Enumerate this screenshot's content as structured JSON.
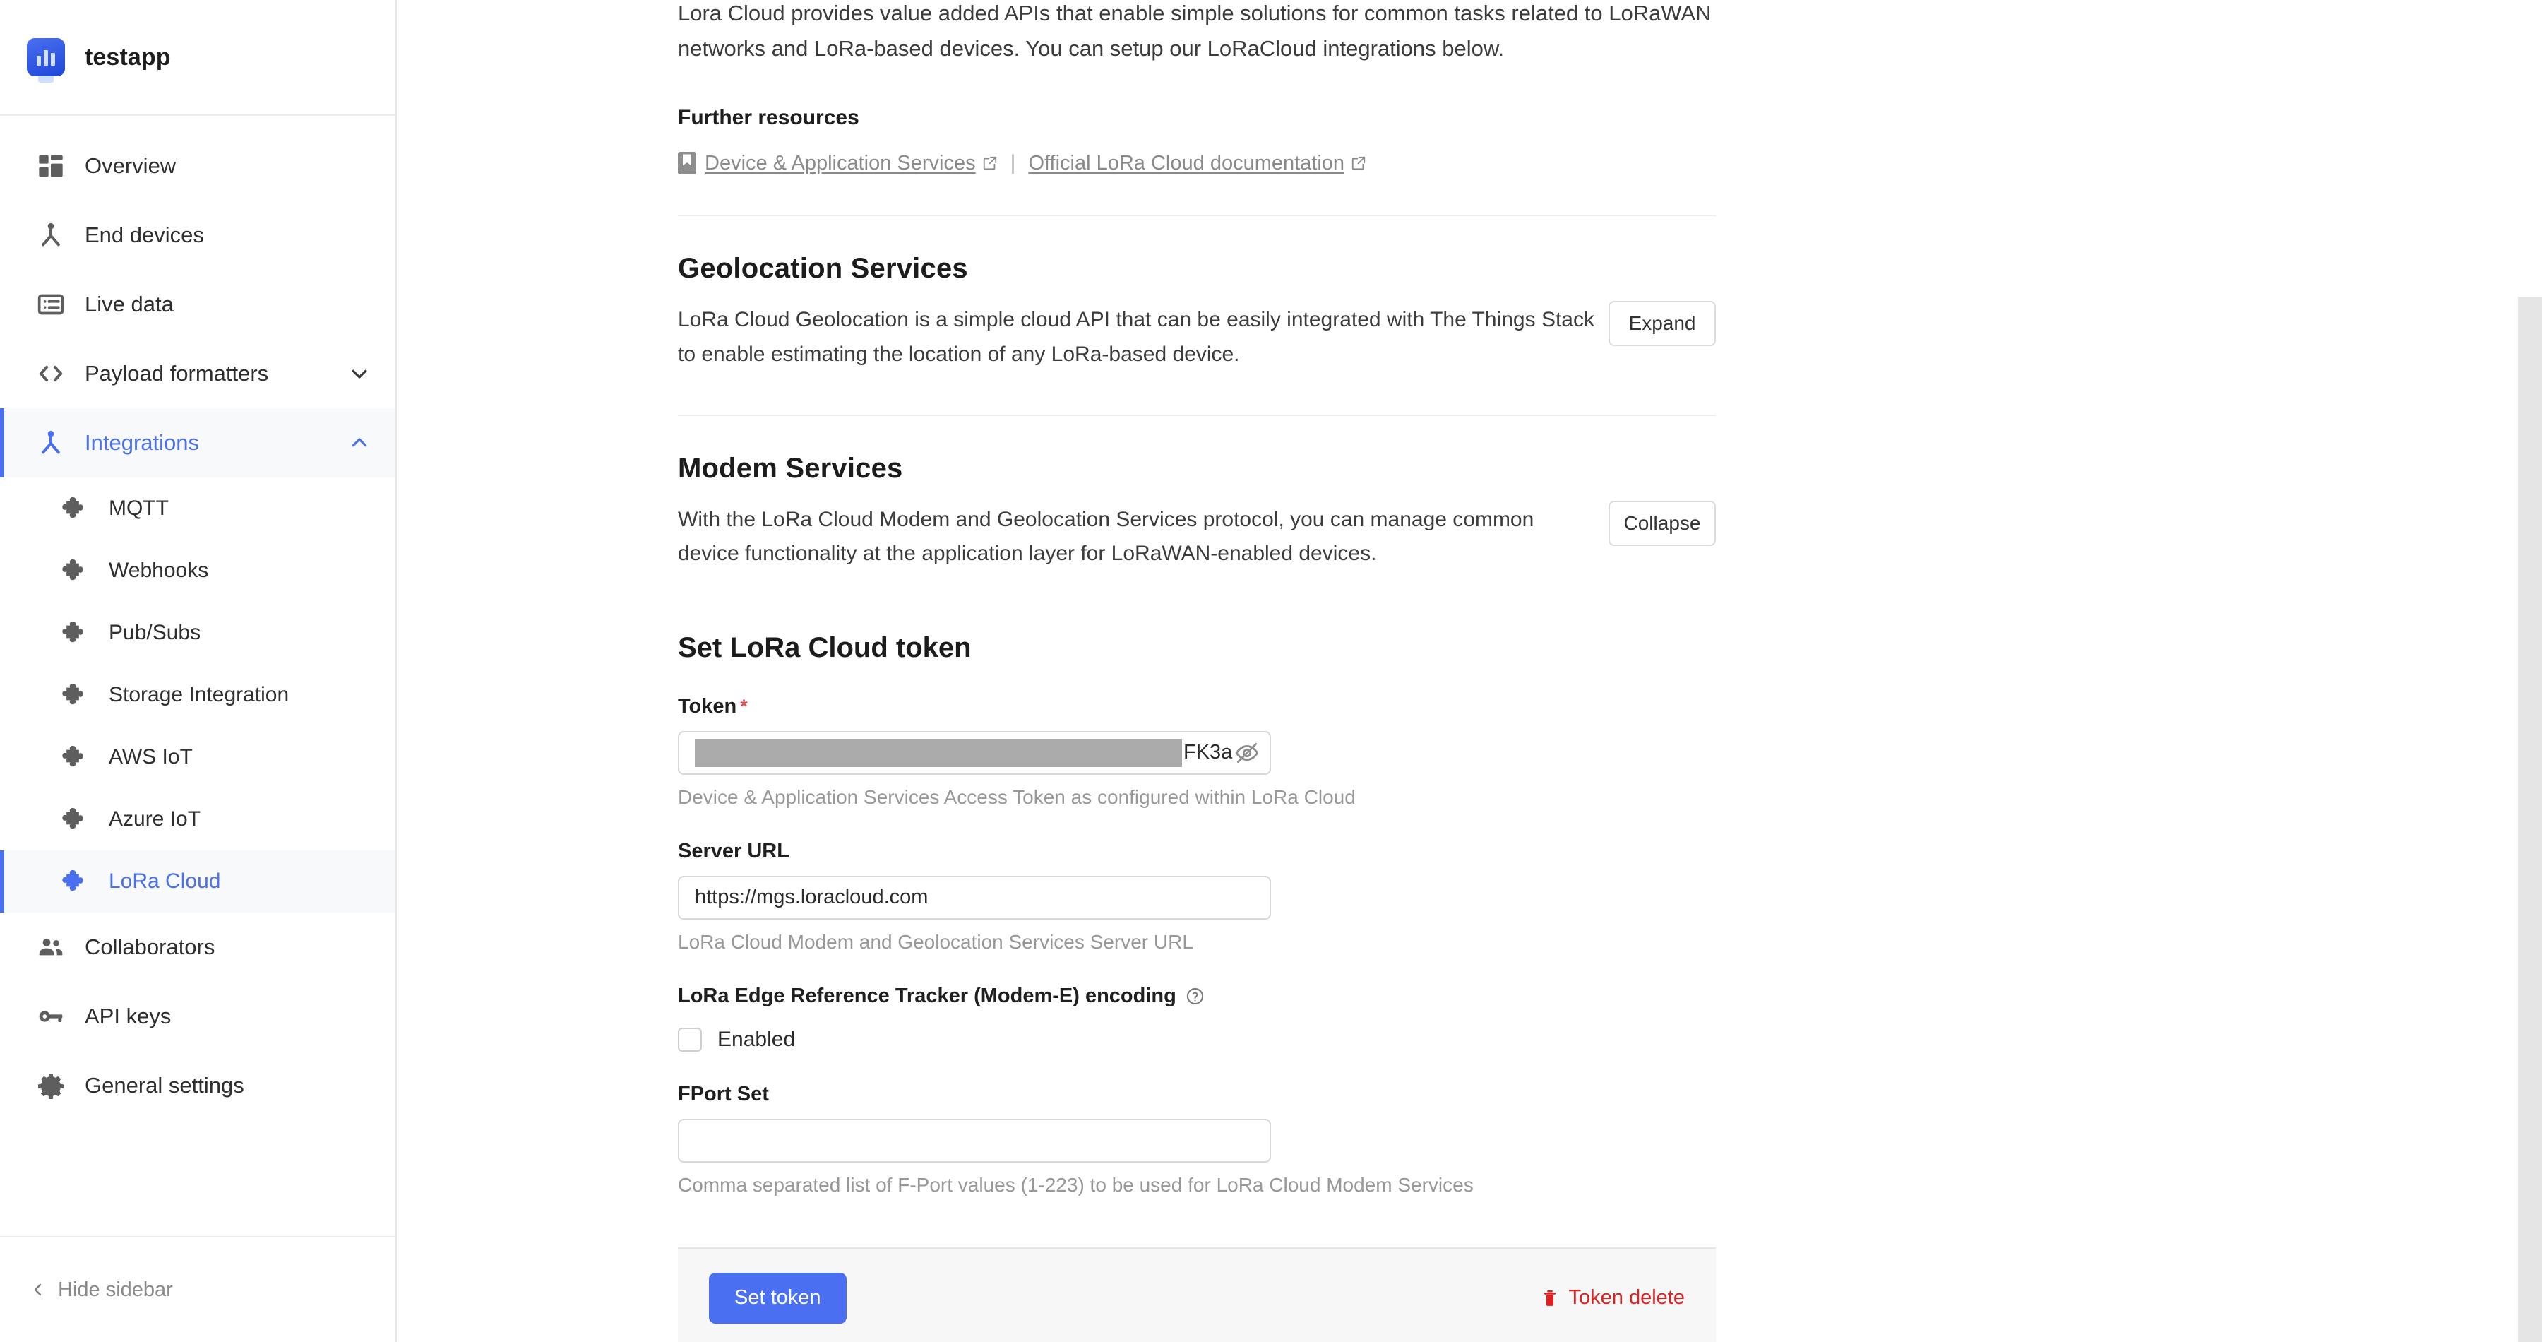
{
  "brand": {
    "name": "testapp",
    "logo_icon": "bar-chart-monitor-icon"
  },
  "sidebar": {
    "items": [
      {
        "label": "Overview",
        "icon": "dashboard-grid-icon",
        "level": "top",
        "active": false,
        "chevron": ""
      },
      {
        "label": "End devices",
        "icon": "end-device-node-icon",
        "level": "top",
        "active": false,
        "chevron": ""
      },
      {
        "label": "Live data",
        "icon": "live-data-list-icon",
        "level": "top",
        "active": false,
        "chevron": ""
      },
      {
        "label": "Payload formatters",
        "icon": "code-brackets-icon",
        "level": "top",
        "active": false,
        "chevron": "chevron-down-icon"
      },
      {
        "label": "Integrations",
        "icon": "integrations-node-icon",
        "level": "top",
        "active": true,
        "chevron": "chevron-up-icon"
      },
      {
        "label": "MQTT",
        "icon": "puzzle-piece-icon",
        "level": "sub",
        "active": false,
        "chevron": ""
      },
      {
        "label": "Webhooks",
        "icon": "puzzle-piece-icon",
        "level": "sub",
        "active": false,
        "chevron": ""
      },
      {
        "label": "Pub/Subs",
        "icon": "puzzle-piece-icon",
        "level": "sub",
        "active": false,
        "chevron": ""
      },
      {
        "label": "Storage Integration",
        "icon": "puzzle-piece-icon",
        "level": "sub",
        "active": false,
        "chevron": ""
      },
      {
        "label": "AWS IoT",
        "icon": "puzzle-piece-icon",
        "level": "sub",
        "active": false,
        "chevron": ""
      },
      {
        "label": "Azure IoT",
        "icon": "puzzle-piece-icon",
        "level": "sub",
        "active": false,
        "chevron": ""
      },
      {
        "label": "LoRa Cloud",
        "icon": "puzzle-piece-icon",
        "level": "sub",
        "active": true,
        "chevron": ""
      },
      {
        "label": "Collaborators",
        "icon": "collaborators-people-icon",
        "level": "top",
        "active": false,
        "chevron": ""
      },
      {
        "label": "API keys",
        "icon": "key-icon",
        "level": "top",
        "active": false,
        "chevron": ""
      },
      {
        "label": "General settings",
        "icon": "gear-icon",
        "level": "top",
        "active": false,
        "chevron": ""
      }
    ],
    "hide_sidebar_label": "Hide sidebar"
  },
  "main": {
    "intro_paragraph": "Lora Cloud provides value added APIs that enable simple solutions for common tasks related to LoRaWAN networks and LoRa-based devices. You can setup our LoRaCloud integrations below.",
    "further_resources_title": "Further resources",
    "resources": [
      {
        "label": "Device & Application Services",
        "icon": "book-icon",
        "external": "external-link-icon"
      },
      {
        "label": "Official LoRa Cloud documentation",
        "icon": "",
        "external": "external-link-icon"
      }
    ],
    "resource_separator": "|",
    "sections": [
      {
        "title": "Geolocation Services",
        "body": "LoRa Cloud Geolocation is a simple cloud API that can be easily integrated with The Things Stack to enable estimating the location of any LoRa-based device.",
        "button": "Expand"
      },
      {
        "title": "Modem Services",
        "body": "With the LoRa Cloud Modem and Geolocation Services protocol, you can manage common device functionality at the application layer for LoRaWAN-enabled devices.",
        "button": "Collapse"
      }
    ],
    "form": {
      "title": "Set LoRa Cloud token",
      "token": {
        "label": "Token",
        "required_marker": "*",
        "value_visible_tail": "FK3a",
        "redacted": true,
        "toggle_icon": "eye-off-icon",
        "hint": "Device & Application Services Access Token as configured within LoRa Cloud"
      },
      "server_url": {
        "label": "Server URL",
        "value": "https://mgs.loracloud.com",
        "hint": "LoRa Cloud Modem and Geolocation Services Server URL"
      },
      "modem_e": {
        "label": "LoRa Edge Reference Tracker (Modem-E) encoding",
        "help_icon": "question-circle-icon",
        "checkbox_label": "Enabled",
        "checked": false
      },
      "fport": {
        "label": "FPort Set",
        "value": "",
        "hint": "Comma separated list of F-Port values (1-223) to be used for LoRa Cloud Modem Services"
      },
      "submit_label": "Set token",
      "delete_label": "Token delete",
      "delete_icon": "trash-icon"
    }
  },
  "colors": {
    "accent": "#4a6ff0",
    "danger": "#e02020",
    "required": "#e5484d",
    "muted_text": "#989898",
    "redaction": "#ababab"
  }
}
